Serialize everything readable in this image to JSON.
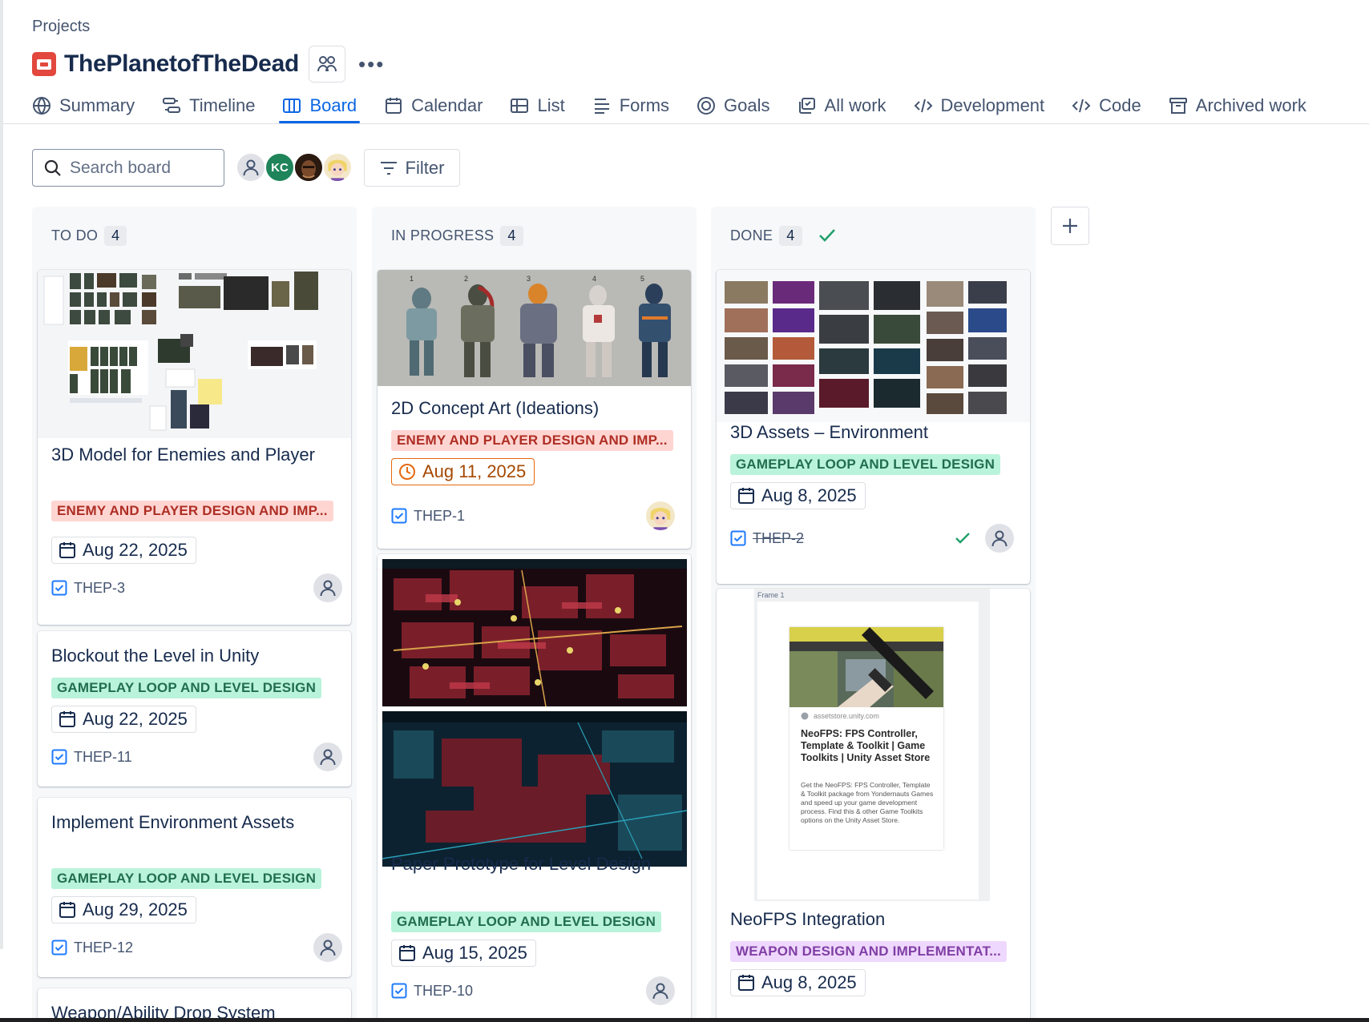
{
  "breadcrumb": "Projects",
  "project": {
    "title": "ThePlanetofTheDead"
  },
  "tabs": [
    {
      "label": "Summary",
      "icon": "globe-icon"
    },
    {
      "label": "Timeline",
      "icon": "timeline-icon"
    },
    {
      "label": "Board",
      "icon": "board-icon",
      "active": true
    },
    {
      "label": "Calendar",
      "icon": "calendar-icon"
    },
    {
      "label": "List",
      "icon": "list-icon"
    },
    {
      "label": "Forms",
      "icon": "forms-icon"
    },
    {
      "label": "Goals",
      "icon": "goals-icon"
    },
    {
      "label": "All work",
      "icon": "all-work-icon"
    },
    {
      "label": "Development",
      "icon": "code-icon"
    },
    {
      "label": "Code",
      "icon": "code-icon"
    },
    {
      "label": "Archived work",
      "icon": "archive-icon"
    }
  ],
  "toolbar": {
    "search_placeholder": "Search board",
    "avatars": [
      {
        "type": "unassigned",
        "initials": ""
      },
      {
        "type": "initials",
        "initials": "KC",
        "color": "#1f845a"
      },
      {
        "type": "photo",
        "initials": ""
      },
      {
        "type": "cartoon",
        "initials": ""
      }
    ],
    "filter_label": "Filter"
  },
  "columns": [
    {
      "name": "TO DO",
      "count": "4",
      "cards": [
        {
          "title": "3D Model for Enemies and Player",
          "label": "ENEMY AND PLAYER DESIGN AND IMP...",
          "label_color": "red",
          "date": "Aug 22, 2025",
          "key": "THEP-3",
          "cover": "concept-board-thumbnail"
        },
        {
          "title": "Blockout the Level in Unity",
          "label": "GAMEPLAY LOOP AND LEVEL DESIGN",
          "label_color": "green",
          "date": "Aug 22, 2025",
          "key": "THEP-11"
        },
        {
          "title": "Implement Environment Assets",
          "label": "GAMEPLAY LOOP AND LEVEL DESIGN",
          "label_color": "green",
          "date": "Aug 29, 2025",
          "key": "THEP-12"
        },
        {
          "title": "Weapon/Ability Drop System"
        }
      ]
    },
    {
      "name": "IN PROGRESS",
      "count": "4",
      "cards": [
        {
          "title": "2D Concept Art (Ideations)",
          "label": "ENEMY AND PLAYER DESIGN AND IMP...",
          "label_color": "red",
          "date": "Aug 11, 2025",
          "date_status": "due-soon",
          "key": "THEP-1",
          "cover": "armor-concept-lineup",
          "cover_numbers": [
            "1",
            "2",
            "3",
            "4",
            "5"
          ]
        },
        {
          "title": "Paper Prototype for Level Design",
          "label": "GAMEPLAY LOOP AND LEVEL DESIGN",
          "label_color": "green",
          "date": "Aug 15, 2025",
          "key": "THEP-10",
          "cover": "city-map-screenshots"
        }
      ]
    },
    {
      "name": "DONE",
      "count": "4",
      "cards": [
        {
          "title": "3D Assets – Environment",
          "label": "GAMEPLAY LOOP AND LEVEL DESIGN",
          "label_color": "green",
          "date": "Aug 8, 2025",
          "key": "THEP-2",
          "resolved": true,
          "cover": "environment-moodboard"
        },
        {
          "title": "NeoFPS Integration",
          "label": "WEAPON DESIGN AND IMPLEMENTAT...",
          "label_color": "purple",
          "date": "Aug 8, 2025",
          "cover": "asset-store-frame",
          "frame": {
            "name": "Frame 1",
            "site": "assetstore.unity.com",
            "heading": "NeoFPS: FPS Controller, Template & Toolkit | Game Toolkits | Unity Asset Store",
            "desc": "Get the NeoFPS: FPS Controller, Template & Toolkit package from Yondernauts Games and speed up your game development process. Find this & other Game Toolkits options on the Unity Asset Store."
          }
        }
      ]
    }
  ],
  "colors": {
    "accent": "#0c66e4",
    "done_check": "#22a06b",
    "warn": "#e56910"
  }
}
